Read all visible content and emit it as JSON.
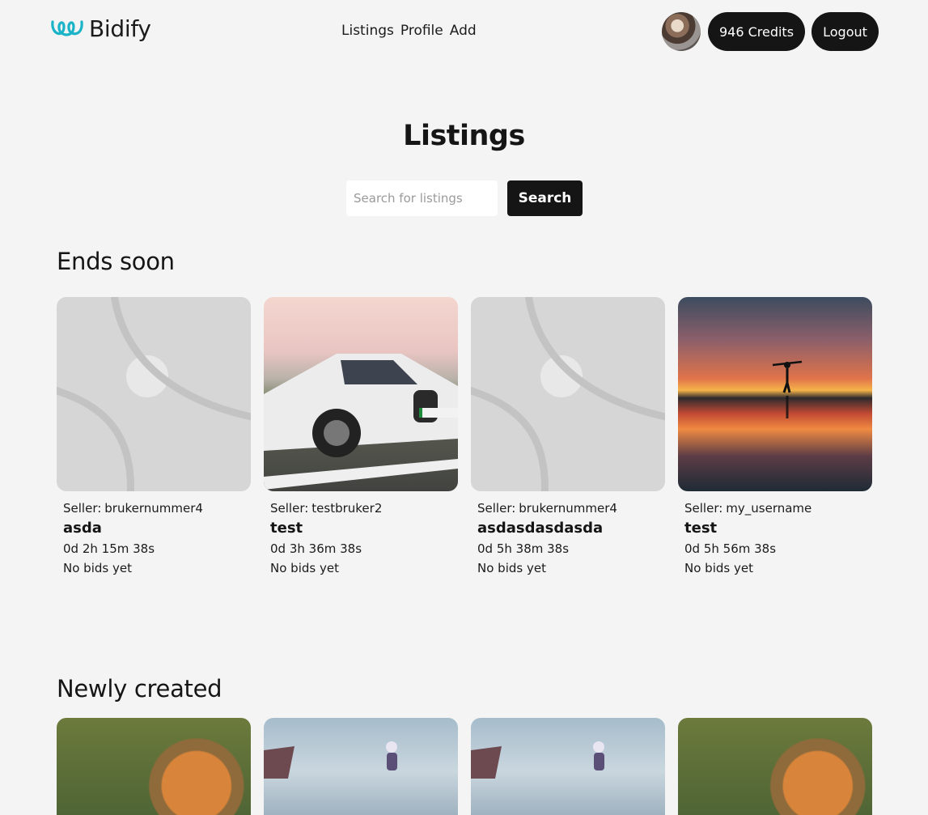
{
  "brand": {
    "name": "Bidify"
  },
  "nav": {
    "listings": "Listings",
    "profile": "Profile",
    "add": "Add"
  },
  "header": {
    "credits": "946 Credits",
    "logout": "Logout"
  },
  "page": {
    "title": "Listings"
  },
  "search": {
    "placeholder": "Search for listings",
    "button": "Search"
  },
  "sections": {
    "ends_soon": "Ends soon",
    "newly_created": "Newly created"
  },
  "ends_soon": [
    {
      "seller_label": "Seller:",
      "seller": "brukernummer4",
      "title": "asda",
      "timer": "0d 2h 15m 38s",
      "bids": "No bids yet",
      "image": "placeholder"
    },
    {
      "seller_label": "Seller:",
      "seller": "testbruker2",
      "title": "test",
      "timer": "0d 3h 36m 38s",
      "bids": "No bids yet",
      "image": "car"
    },
    {
      "seller_label": "Seller:",
      "seller": "brukernummer4",
      "title": "asdasdasdasda",
      "timer": "0d 5h 38m 38s",
      "bids": "No bids yet",
      "image": "placeholder"
    },
    {
      "seller_label": "Seller:",
      "seller": "my_username",
      "title": "test",
      "timer": "0d 5h 56m 38s",
      "bids": "No bids yet",
      "image": "sunset"
    }
  ],
  "newly_created": [
    {
      "image": "tiger"
    },
    {
      "image": "robot"
    },
    {
      "image": "robot"
    },
    {
      "image": "tiger"
    }
  ],
  "colors": {
    "accent": "#1bb3c7",
    "dark": "#151515",
    "background": "#f4f4f4"
  }
}
